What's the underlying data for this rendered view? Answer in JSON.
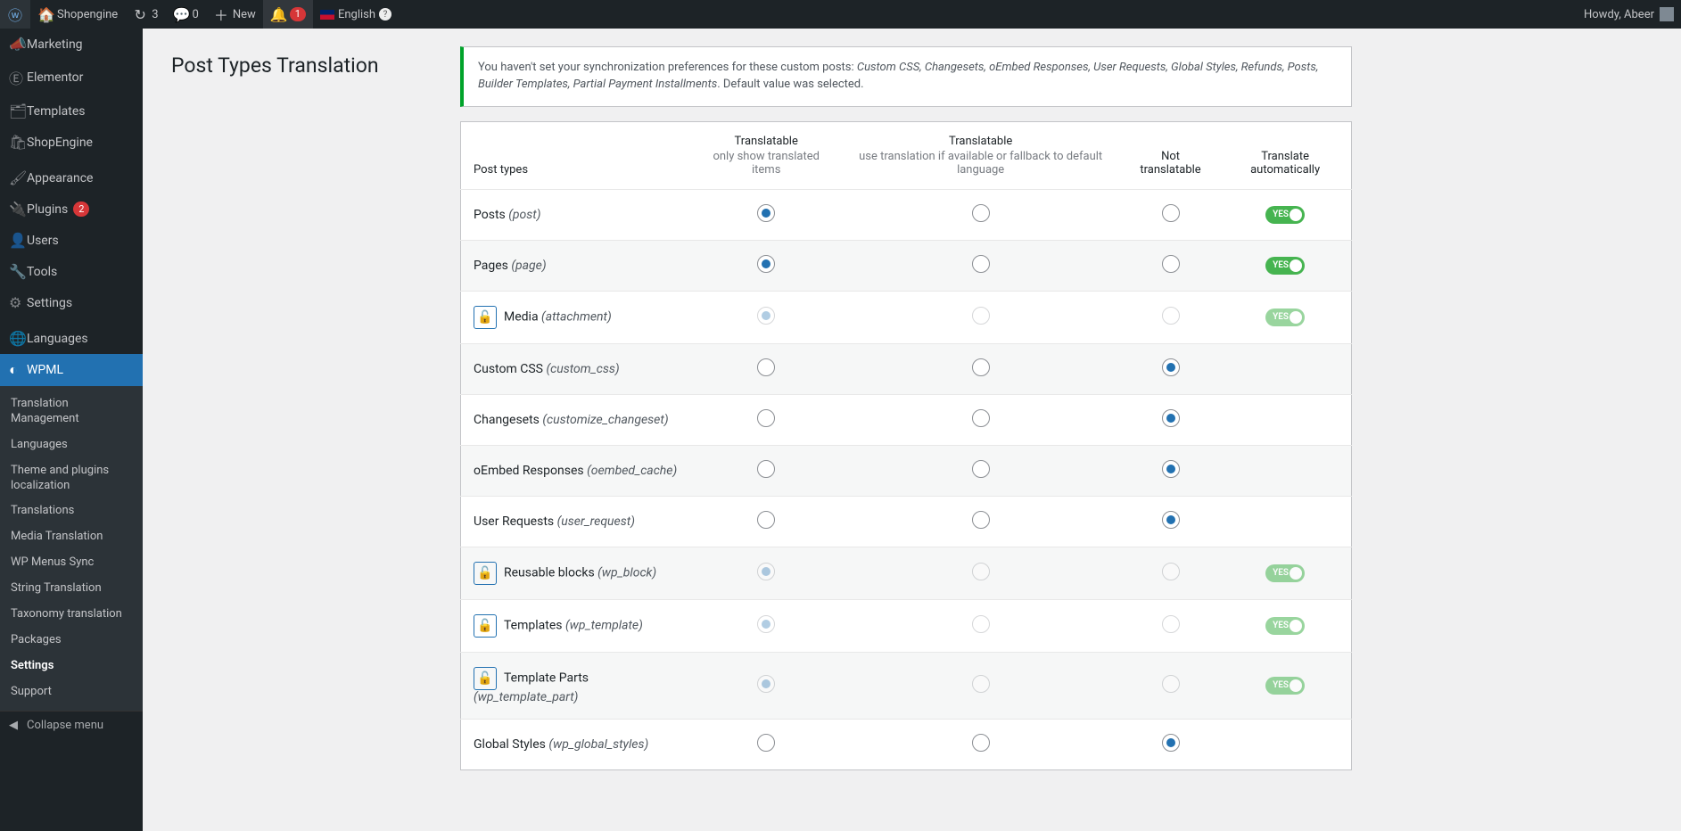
{
  "adminbar": {
    "site_name": "Shopengine",
    "refresh_count": "3",
    "comments_count": "0",
    "new_label": "New",
    "notif_count": "1",
    "language_label": "English",
    "howdy": "Howdy, Abeer"
  },
  "sidebar": {
    "top": [
      {
        "icon": "📣",
        "label": "Marketing"
      },
      {
        "icon": "Ⓔ",
        "label": "Elementor"
      },
      {
        "icon": "🗂",
        "label": "Templates"
      },
      {
        "icon": "🛍",
        "label": "ShopEngine"
      }
    ],
    "mid": [
      {
        "icon": "🖌",
        "label": "Appearance"
      },
      {
        "icon": "🔌",
        "label": "Plugins",
        "badge": "2"
      },
      {
        "icon": "👤",
        "label": "Users"
      },
      {
        "icon": "🔧",
        "label": "Tools"
      },
      {
        "icon": "⚙",
        "label": "Settings"
      }
    ],
    "lang_label": "Languages",
    "wpml_label": "WPML",
    "submenu": [
      "Translation Management",
      "Languages",
      "Theme and plugins localization",
      "Translations",
      "Media Translation",
      "WP Menus Sync",
      "String Translation",
      "Taxonomy translation",
      "Packages",
      "Settings",
      "Support"
    ],
    "current_sub": "Settings",
    "collapse_label": "Collapse menu"
  },
  "page": {
    "title": "Post Types Translation",
    "notice_pre": "You haven't set your synchronization preferences for these custom posts: ",
    "notice_items": "Custom CSS, Changesets, oEmbed Responses, User Requests, Global Styles, Refunds, Posts, Builder Templates, Partial Payment Installments",
    "notice_post": ". Default value was selected."
  },
  "table": {
    "headers": {
      "col1": "Post types",
      "col2": "Translatable",
      "col2_sub": "only show translated items",
      "col3": "Translatable",
      "col3_sub": "use translation if available or fallback to default language",
      "col4": "Not translatable",
      "col5": "Translate automatically"
    },
    "toggle_on": "YES",
    "rows": [
      {
        "label": "Posts",
        "slug": "post",
        "lock": false,
        "sel": 1,
        "toggle": "on"
      },
      {
        "label": "Pages",
        "slug": "page",
        "lock": false,
        "sel": 1,
        "toggle": "on"
      },
      {
        "label": "Media",
        "slug": "attachment",
        "lock": true,
        "sel": 1,
        "toggle": "on-disabled"
      },
      {
        "label": "Custom CSS",
        "slug": "custom_css",
        "lock": false,
        "sel": 3,
        "toggle": "none"
      },
      {
        "label": "Changesets",
        "slug": "customize_changeset",
        "lock": false,
        "sel": 3,
        "toggle": "none"
      },
      {
        "label": "oEmbed Responses",
        "slug": "oembed_cache",
        "lock": false,
        "sel": 3,
        "toggle": "none"
      },
      {
        "label": "User Requests",
        "slug": "user_request",
        "lock": false,
        "sel": 3,
        "toggle": "none"
      },
      {
        "label": "Reusable blocks",
        "slug": "wp_block",
        "lock": true,
        "sel": 1,
        "toggle": "on-disabled"
      },
      {
        "label": "Templates",
        "slug": "wp_template",
        "lock": true,
        "sel": 1,
        "toggle": "on-disabled"
      },
      {
        "label": "Template Parts",
        "slug": "wp_template_part",
        "lock": true,
        "sel": 1,
        "toggle": "on-disabled"
      },
      {
        "label": "Global Styles",
        "slug": "wp_global_styles",
        "lock": false,
        "sel": 3,
        "toggle": "none"
      }
    ]
  }
}
